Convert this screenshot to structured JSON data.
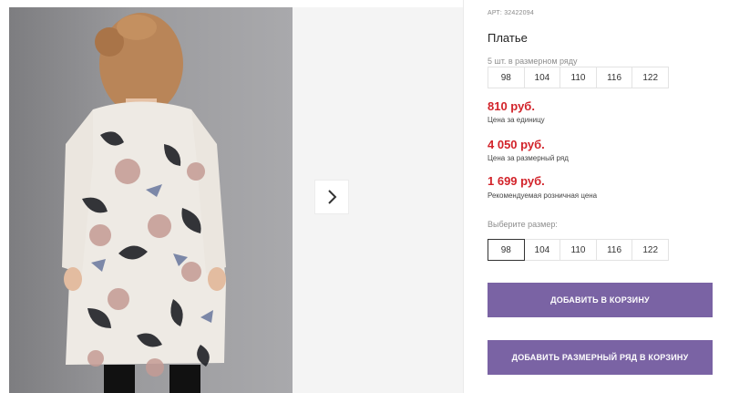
{
  "gallery": {
    "photo_alt": "",
    "next_icon": "chevron-right-icon"
  },
  "product": {
    "article": "АРТ: 32422094",
    "title": "Платье",
    "size_run_label": "5 шт. в размерном ряду",
    "size_run": [
      "98",
      "104",
      "110",
      "116",
      "122"
    ],
    "price_unit": "810 руб.",
    "price_unit_label": "Цена за единицу",
    "price_run": "4 050 руб.",
    "price_run_label": "Цена за размерный ряд",
    "price_retail": "1 699 руб.",
    "price_retail_label": "Рекомендуемая розничная цена",
    "choose_size_label": "Выберите размер:",
    "sizes": [
      "98",
      "104",
      "110",
      "116",
      "122"
    ],
    "selected_size": "98",
    "add_to_cart": "ДОБАВИТЬ В КОРЗИНУ",
    "add_run_to_cart": "ДОБАВИТЬ РАЗМЕРНЫЙ РЯД В КОРЗИНУ"
  },
  "colors": {
    "accent": "#7a63a4",
    "price": "#d2232a"
  }
}
